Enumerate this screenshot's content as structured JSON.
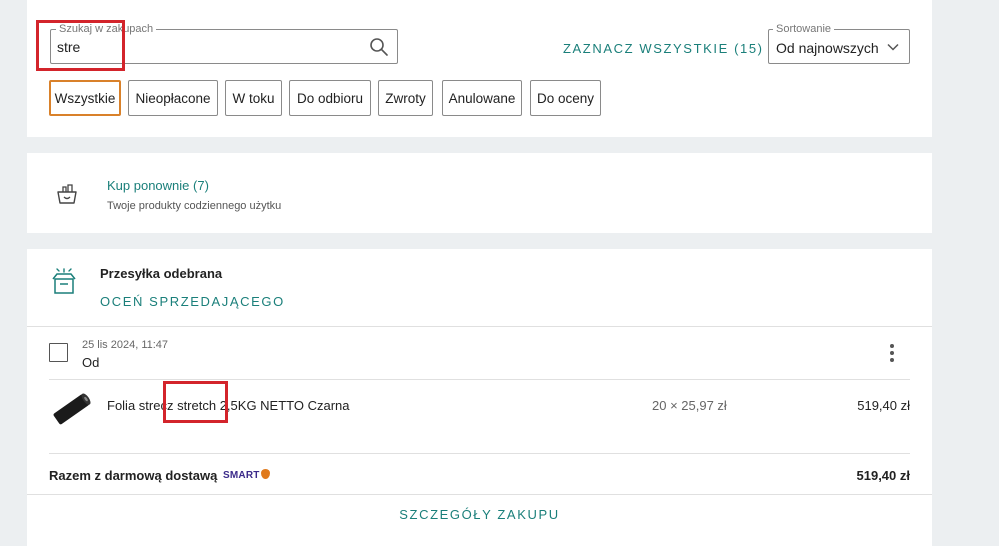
{
  "search": {
    "legend": "Szukaj w zakupach",
    "value": "stre"
  },
  "select_all": "ZAZNACZ WSZYSTKIE (15)",
  "sort": {
    "legend": "Sortowanie",
    "value": "Od najnowszych"
  },
  "filters": [
    "Wszystkie",
    "Nieopłacone",
    "W toku",
    "Do odbioru",
    "Zwroty",
    "Anulowane",
    "Do oceny"
  ],
  "active_filter": "Wszystkie",
  "rebuy": {
    "title": "Kup ponownie (7)",
    "subtitle": "Twoje produkty codziennego użytku"
  },
  "order": {
    "status": "Przesyłka odebrana",
    "rate_seller": "OCEŃ SPRZEDAJĄCEGO",
    "date": "25 lis 2024, 11:47",
    "from_label": "Od",
    "product": {
      "name": "Folia strecz stretch 2,5KG NETTO Czarna",
      "qty_price": "20 × 25,97 zł",
      "total": "519,40 zł"
    },
    "sum_label": "Razem z darmową dostawą",
    "smart_badge": "SMART",
    "sum_value": "519,40 zł",
    "details_link": "SZCZEGÓŁY ZAKUPU"
  },
  "colors": {
    "accent_teal": "#1a7f7a",
    "active_chip": "#d9812a",
    "highlight_red": "#d3242b",
    "background": "#eceff1"
  },
  "icons": {
    "search": "search-icon",
    "sort": "chevron-down-icon",
    "rebuy": "basket-icon",
    "status": "package-box-icon",
    "menu": "kebab-icon"
  }
}
